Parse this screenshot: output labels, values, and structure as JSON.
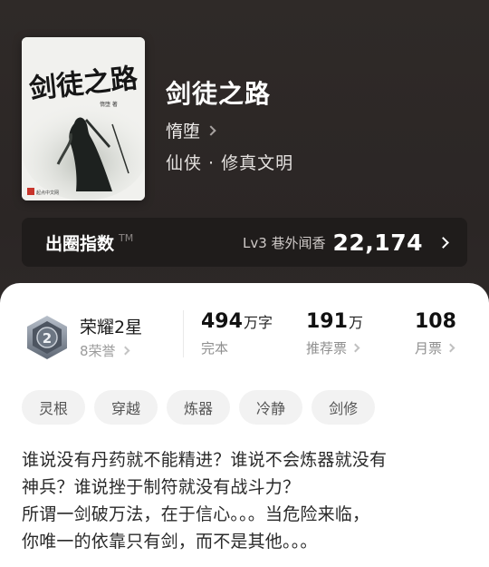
{
  "book": {
    "title": "剑徒之路",
    "author": "惰堕",
    "genre": "仙侠 · 修真文明",
    "cover": {
      "title_art": "剑徒之路",
      "author_print": "惰堕 著",
      "publisher_mark": "起点中文网"
    }
  },
  "chuquan": {
    "label": "出圈指数",
    "tm": "TM",
    "level": "Lv3 巷外闻香",
    "value": "22,174"
  },
  "honor": {
    "title": "荣耀2星",
    "subtitle": "8荣誉",
    "badge_number": "2"
  },
  "stats": [
    {
      "value": "494",
      "unit": "万字",
      "label": "完本"
    },
    {
      "value": "191",
      "unit": "万",
      "label": "推荐票"
    },
    {
      "value": "108",
      "unit": "",
      "label": "月票"
    }
  ],
  "tags": [
    "灵根",
    "穿越",
    "炼器",
    "冷静",
    "剑修"
  ],
  "description": [
    "谁说没有丹药就不能精进？谁说不会炼器就没有",
    "神兵？谁说挫于制符就没有战斗力？",
    "所谓一剑破万法，在于信心。。。当危险来临，",
    "你唯一的依靠只有剑，而不是其他。。。"
  ],
  "colors": {
    "accent": "#1f1c1b",
    "card": "#ffffff",
    "tag_bg": "#f2f2f2"
  }
}
